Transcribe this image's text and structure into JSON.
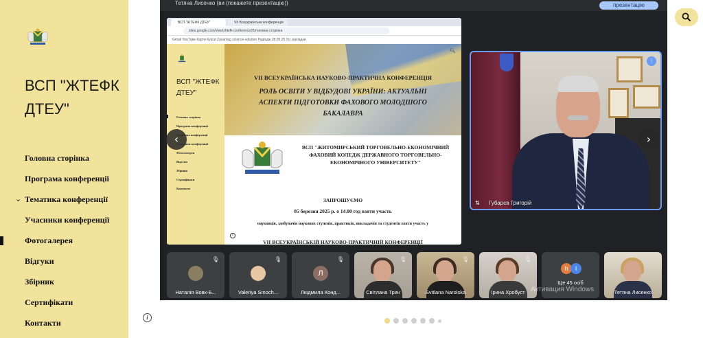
{
  "site": {
    "title": "ВСП \"ЖТЕФК ДТЕУ\"",
    "nav": [
      {
        "label": "Головна сторінка"
      },
      {
        "label": "Програма конференції"
      },
      {
        "label": "Тематика конференції",
        "has_chevron": true
      },
      {
        "label": "Учасники конференції"
      },
      {
        "label": "Фотогалерея",
        "active": true
      },
      {
        "label": "Відгуки"
      },
      {
        "label": "Збірник"
      },
      {
        "label": "Сертифікати"
      },
      {
        "label": "Контакти"
      }
    ],
    "colors": {
      "sidebar_bg": "#f2e39c",
      "accent": "#efd987"
    }
  },
  "carousel": {
    "prev_icon": "chevron-left-icon",
    "next_icon": "chevron-right-icon",
    "prev_glyph": "‹",
    "next_glyph": "›",
    "dot_count": 7,
    "active_dot": 0
  },
  "meet": {
    "presenter_label": "Тетяна Лисенко (ви (покажете презентацію))",
    "present_button": "презентацію",
    "speaker": {
      "name": "Губарєв Григорій"
    },
    "participants": [
      {
        "name": "Наталія Вовк-Б...",
        "avatar": "photo"
      },
      {
        "name": "Valeriya Smoch...",
        "avatar": "photo"
      },
      {
        "name": "Людмила Конд...",
        "avatar": "letter",
        "letter": "Л"
      },
      {
        "name": "Світлана Трач",
        "avatar": "video"
      },
      {
        "name": "Svitlana Narolska",
        "avatar": "video"
      },
      {
        "name": "Ірина Хробуст",
        "avatar": "video"
      },
      {
        "name": "Ще 45 осіб",
        "avatar": "group",
        "letters": [
          "h",
          "I"
        ]
      },
      {
        "name": "Тетяна Лисенко",
        "avatar": "video"
      }
    ],
    "watermark": "Активация Windows"
  },
  "shared_screen": {
    "tabs": [
      "ВСП \"ЖТЕФК ДТЕУ\"",
      "VII Всеукраїнська конференція"
    ],
    "url": "sites.google.com/view/zhtefk-conference25/головна-сторінка",
    "bookmarks": "Gmail   YouTube   Карти   Курси   Zavantag   science-solution   Радіодж 28.05.25   Усі закладки",
    "inner_title": "ВСП \"ЖТЕФК ДТЕУ\"",
    "inner_nav": [
      "Головна сторінка",
      "Програма конференції",
      "Тематика конференції",
      "Учасники конференції",
      "Фотогалерея",
      "Відгуки",
      "Збірник",
      "Сертифікати",
      "Контакти"
    ],
    "conference_line": "VII ВСЕУКРАЇНСЬКА НАУКОВО-ПРАКТИЧНА КОНФЕРЕНЦІЯ",
    "conference_theme": "РОЛЬ ОСВІТИ У ВІДБУДОВІ УКРАЇНИ: АКТУАЛЬНІ АСПЕКТИ ПІДГОТОВКИ ФАХОВОГО МОЛОДШОГО БАКАЛАВРА",
    "college_name": "ВСП \"ЖИТОМИРСЬКИЙ ТОРГОВЕЛЬНО-ЕКОНОМІЧНИЙ ФАХОВИЙ КОЛЕДЖ ДЕРЖАВНОГО ТОРГОВЕЛЬНО-ЕКОНОМІЧНОГО УНІВЕРСИТЕТУ\"",
    "invite": "ЗАПРОШУЄМО",
    "date_line": "05 березня 2025 р. о 14.00 год взяти участь",
    "audience": "науковців, здобувачів наукових ступенів, практиків, викладачів та студентів взяти участь у",
    "conference_repeat": "VII ВСЕУКРАЇНСЬКІЙ НАУКОВО-ПРАКТИЧНІЙ КОНФЕРЕНЦІЇ"
  },
  "icons": {
    "search": "search-icon",
    "info": "info-icon"
  }
}
